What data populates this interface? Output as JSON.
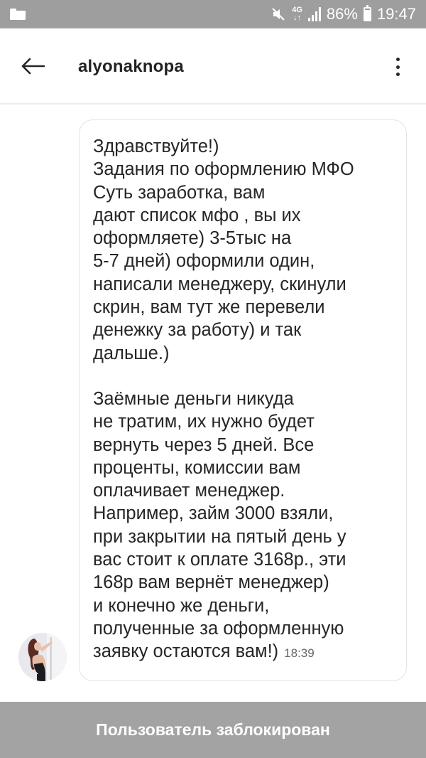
{
  "status_bar": {
    "network_type": "4G",
    "network_arrows": "↓↑",
    "battery": "86%",
    "battery_level": 0.86,
    "time": "19:47",
    "icons": [
      "folder-icon",
      "mute-icon",
      "signal-icon",
      "battery-icon"
    ]
  },
  "header": {
    "username": "alyonaknopa",
    "icons": [
      "back-arrow-icon",
      "more-vert-icon"
    ]
  },
  "message": {
    "paragraph1": [
      "Здравствуйте!)",
      "Задания по оформлению МФО",
      "Суть заработка, вам",
      "дают список мфо , вы их",
      "оформляете) 3-5тыс на",
      "5-7 дней) оформили один,",
      "написали менеджеру, скинули",
      "скрин, вам тут же перевели",
      "денежку за работу) и так",
      "дальше.)"
    ],
    "paragraph2": [
      "Заёмные деньги никуда",
      "не тратим, их нужно будет",
      "вернуть через 5 дней. Все",
      "проценты, комиссии вам",
      "оплачивает менеджер.",
      "Например, займ 3000 взяли,",
      "при закрытии на пятый день у",
      "вас стоит к оплате 3168р., эти",
      "168р вам вернёт менеджер)",
      "и конечно же деньги,",
      "полученные за оформленную"
    ],
    "last_line": "заявку остаются вам!)",
    "time": "18:39"
  },
  "banner": {
    "text": "Пользователь заблокирован"
  },
  "colors": {
    "status_bar": "#9e9e9e",
    "banner": "#a3a3a3",
    "bubble_border": "#e3e3e3",
    "text": "#262626"
  }
}
